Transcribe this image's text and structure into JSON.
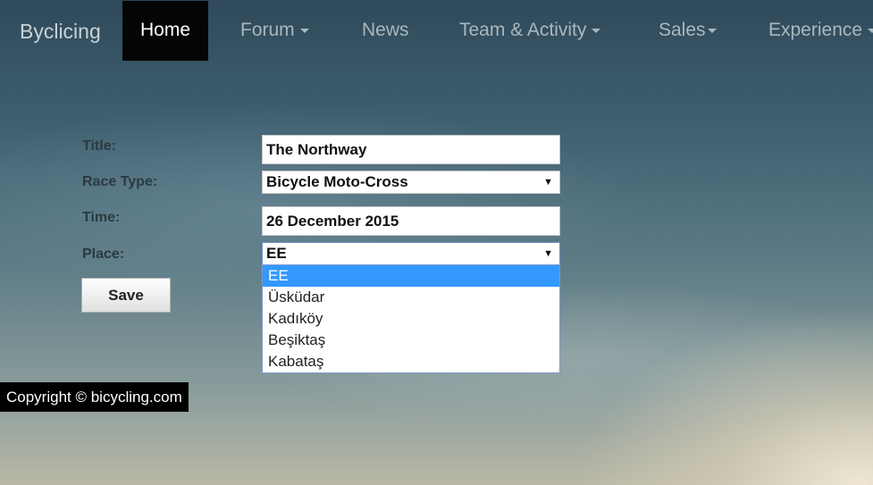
{
  "navbar": {
    "brand": "Byclicing",
    "items": [
      {
        "label": "Home"
      },
      {
        "label": "Forum"
      },
      {
        "label": "News"
      },
      {
        "label": "Team & Activity"
      },
      {
        "label": "Sales"
      },
      {
        "label": "Experience"
      }
    ]
  },
  "form": {
    "title_label": "Title:",
    "title_value": "The Northway",
    "race_type_label": "Race Type:",
    "race_type_value": "Bicycle Moto-Cross",
    "time_label": "Time:",
    "time_value": "26 December 2015",
    "place_label": "Place:",
    "place_value": "EE",
    "place_options": [
      "EE",
      "Üsküdar",
      "Kadıköy",
      "Beşiktaş",
      "Kabataş"
    ],
    "save_label": "Save"
  },
  "footer": {
    "copyright": "Copyright © bicycling.com"
  }
}
